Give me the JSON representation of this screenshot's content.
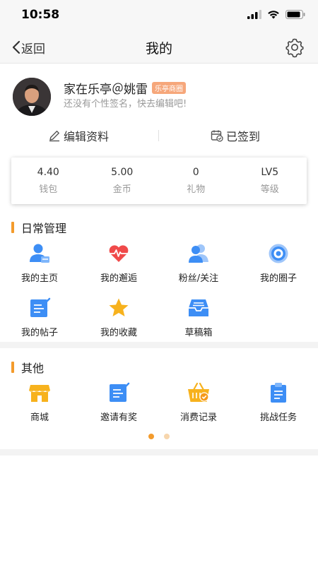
{
  "status_bar": {
    "time": "10:58"
  },
  "nav": {
    "back_label": "返回",
    "title": "我的"
  },
  "profile": {
    "nickname": "家在乐亭＠姚雷",
    "tag": "乐亭商圈",
    "signature": "还没有个性签名，快去编辑吧!",
    "edit_label": "编辑资料",
    "signed_label": "已签到"
  },
  "stats": [
    {
      "value": "4.40",
      "label": "钱包"
    },
    {
      "value": "5.00",
      "label": "金币"
    },
    {
      "value": "0",
      "label": "礼物"
    },
    {
      "value": "LV5",
      "label": "等级"
    }
  ],
  "daily": {
    "title": "日常管理",
    "items": [
      {
        "label": "我的主页",
        "icon": "user-home-icon"
      },
      {
        "label": "我的邂逅",
        "icon": "heart-pulse-icon"
      },
      {
        "label": "粉丝/关注",
        "icon": "fans-icon"
      },
      {
        "label": "我的圈子",
        "icon": "circle-target-icon"
      },
      {
        "label": "我的帖子",
        "icon": "post-edit-icon"
      },
      {
        "label": "我的收藏",
        "icon": "star-icon"
      },
      {
        "label": "草稿箱",
        "icon": "inbox-tray-icon"
      }
    ]
  },
  "other": {
    "title": "其他",
    "items": [
      {
        "label": "商城",
        "icon": "shop-icon"
      },
      {
        "label": "邀请有奖",
        "icon": "invite-edit-icon"
      },
      {
        "label": "消费记录",
        "icon": "basket-check-icon"
      },
      {
        "label": "挑战任务",
        "icon": "clipboard-task-icon"
      }
    ]
  },
  "pager": {
    "pages": 2,
    "active": 1
  },
  "colors": {
    "accent": "#f39b2c",
    "icon_blue": "#3d8ef5",
    "icon_red": "#f04a4a",
    "icon_yellow": "#f7b21d",
    "tag_bg": "#f6a77b"
  }
}
